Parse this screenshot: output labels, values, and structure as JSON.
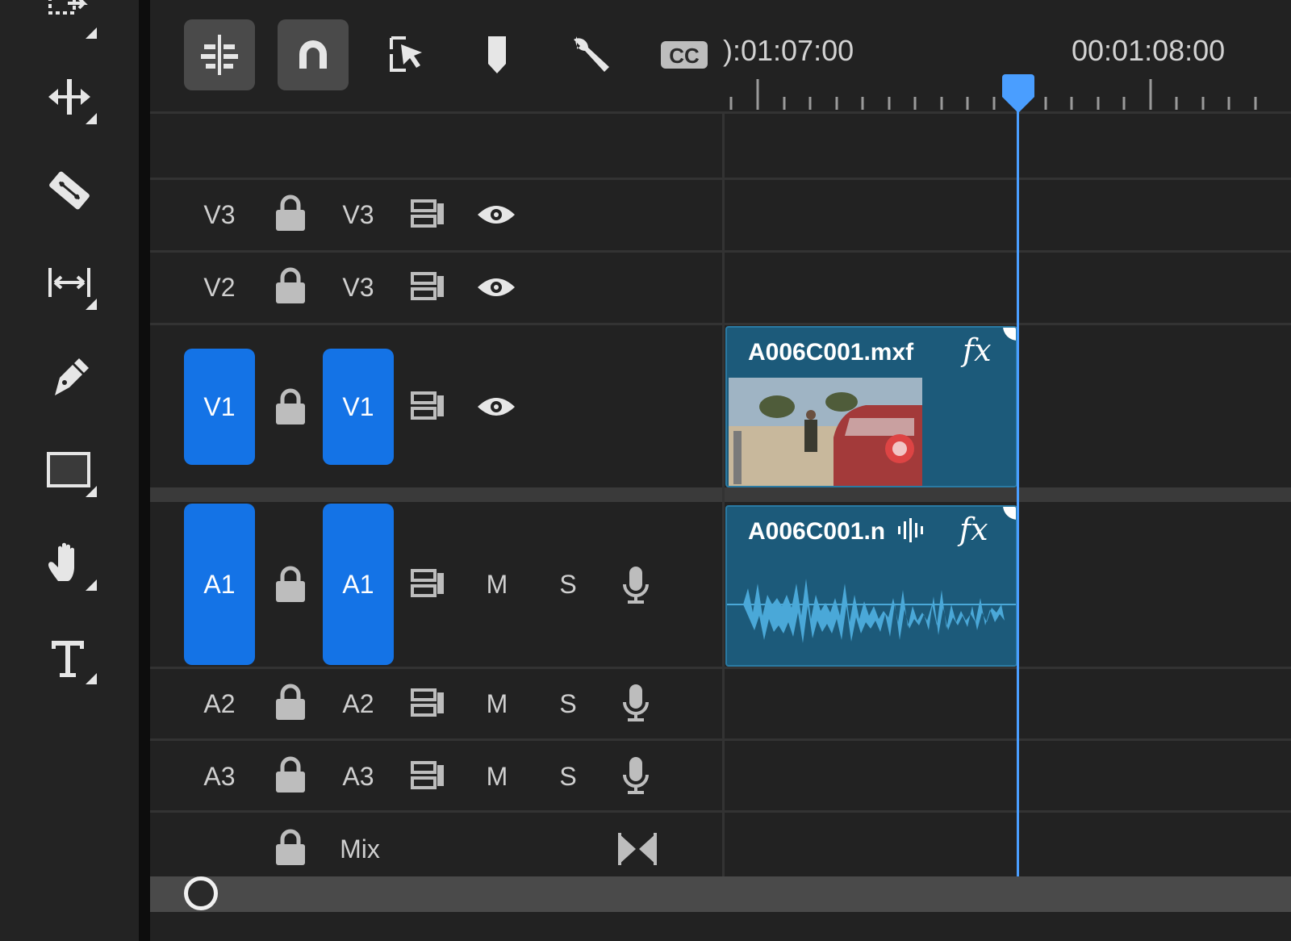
{
  "tools": {
    "items": [
      {
        "name": "track-select-forward-tool"
      },
      {
        "name": "ripple-edit-tool"
      },
      {
        "name": "razor-tool"
      },
      {
        "name": "slip-tool"
      },
      {
        "name": "pen-tool"
      },
      {
        "name": "rectangle-tool"
      },
      {
        "name": "hand-tool"
      },
      {
        "name": "type-tool"
      }
    ]
  },
  "toolbar": {
    "buttons": [
      {
        "name": "nest-sequence-icon",
        "active": true
      },
      {
        "name": "snap-icon",
        "active": true
      },
      {
        "name": "linked-selection-icon",
        "active": false
      },
      {
        "name": "add-marker-icon",
        "active": false
      },
      {
        "name": "timeline-settings-wrench-icon",
        "active": false
      },
      {
        "name": "captions-cc-icon",
        "active": false
      }
    ],
    "timecode_left": "):01:07:00",
    "timecode_right": "00:01:08:00"
  },
  "tracks": {
    "video": [
      {
        "source": "V3",
        "target": "V3",
        "targeted": false
      },
      {
        "source": "V2",
        "target": "V3",
        "targeted": false
      },
      {
        "source": "V1",
        "target": "V1",
        "targeted": true
      }
    ],
    "audio": [
      {
        "source": "A1",
        "target": "A1",
        "targeted": true,
        "mute": "M",
        "solo": "S"
      },
      {
        "source": "A2",
        "target": "A2",
        "targeted": false,
        "mute": "M",
        "solo": "S"
      },
      {
        "source": "A3",
        "target": "A3",
        "targeted": false,
        "mute": "M",
        "solo": "S"
      }
    ],
    "mix_label": "Mix"
  },
  "clips": {
    "video_name": "A006C001.mxf",
    "audio_name": "A006C001.n",
    "fx_label": "fx"
  },
  "colors": {
    "accent": "#1473e6",
    "clip_fill": "#1c5a7a",
    "waveform": "#4aa8d8",
    "playhead": "#4a9eff"
  }
}
